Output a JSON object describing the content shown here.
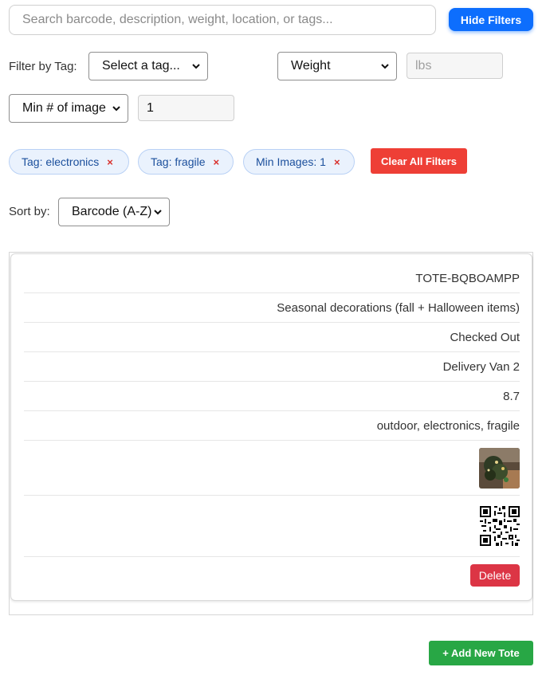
{
  "search": {
    "placeholder": "Search barcode, description, weight, location, or tags..."
  },
  "toolbar": {
    "hide_filters_label": "Hide Filters"
  },
  "filters": {
    "tag_label": "Filter by Tag:",
    "tag_select_value": "Select a tag...",
    "weight_select_value": "Weight",
    "weight_input_placeholder": "lbs",
    "min_images_select_value": "Min # of image",
    "min_images_value": "1"
  },
  "active_filters": [
    {
      "label": "Tag: electronics",
      "remove": "×"
    },
    {
      "label": "Tag: fragile",
      "remove": "×"
    },
    {
      "label": "Min Images: 1",
      "remove": "×"
    }
  ],
  "clear_all_label": "Clear All Filters",
  "sort": {
    "label": "Sort by:",
    "value": "Barcode (A-Z)"
  },
  "tote": {
    "barcode": "TOTE-BQBOAMPP",
    "description": "Seasonal decorations (fall + Halloween items)",
    "status": "Checked Out",
    "location": "Delivery Van 2",
    "weight": "8.7",
    "tags": "outdoor, electronics, fragile",
    "image_icon": "photo-thumbnail",
    "qr_icon": "qr-code-icon",
    "delete_label": "Delete"
  },
  "add_label": "+ Add New Tote",
  "colors": {
    "primary": "#0d6efd",
    "danger": "#dc3545",
    "clear": "#ee3f36",
    "success": "#28a745",
    "chip_bg": "#eaf2fd",
    "chip_text": "#1b4f9c"
  }
}
